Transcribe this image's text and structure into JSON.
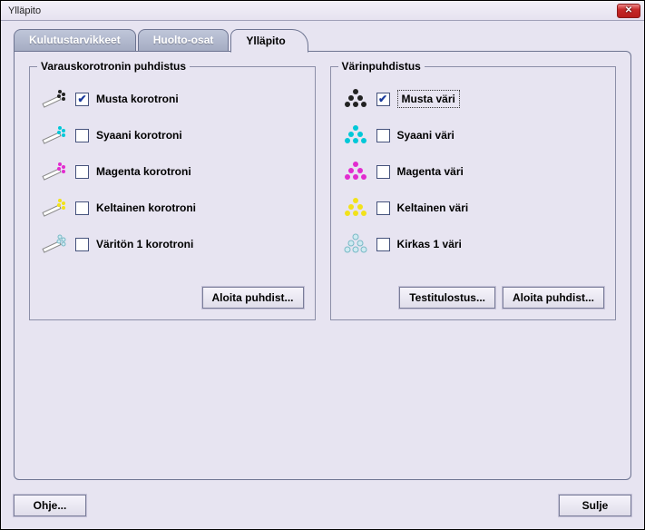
{
  "window": {
    "title": "Ylläpito"
  },
  "tabs": {
    "t0": "Kulutustarvikkeet",
    "t1": "Huolto-osat",
    "t2": "Ylläpito"
  },
  "left": {
    "title": "Varauskorotronin puhdistus",
    "items": [
      {
        "label": "Musta korotroni",
        "checked": true
      },
      {
        "label": "Syaani korotroni",
        "checked": false
      },
      {
        "label": "Magenta korotroni",
        "checked": false
      },
      {
        "label": "Keltainen korotroni",
        "checked": false
      },
      {
        "label": "Väritön 1 korotroni",
        "checked": false
      }
    ],
    "start_label": "Aloita puhdist..."
  },
  "right": {
    "title": "Värinpuhdistus",
    "items": [
      {
        "label": "Musta väri",
        "checked": true
      },
      {
        "label": "Syaani väri",
        "checked": false
      },
      {
        "label": "Magenta väri",
        "checked": false
      },
      {
        "label": "Keltainen väri",
        "checked": false
      },
      {
        "label": "Kirkas 1 väri",
        "checked": false
      }
    ],
    "test_label": "Testitulostus...",
    "start_label": "Aloita puhdist..."
  },
  "buttons": {
    "help": "Ohje...",
    "close": "Sulje"
  }
}
